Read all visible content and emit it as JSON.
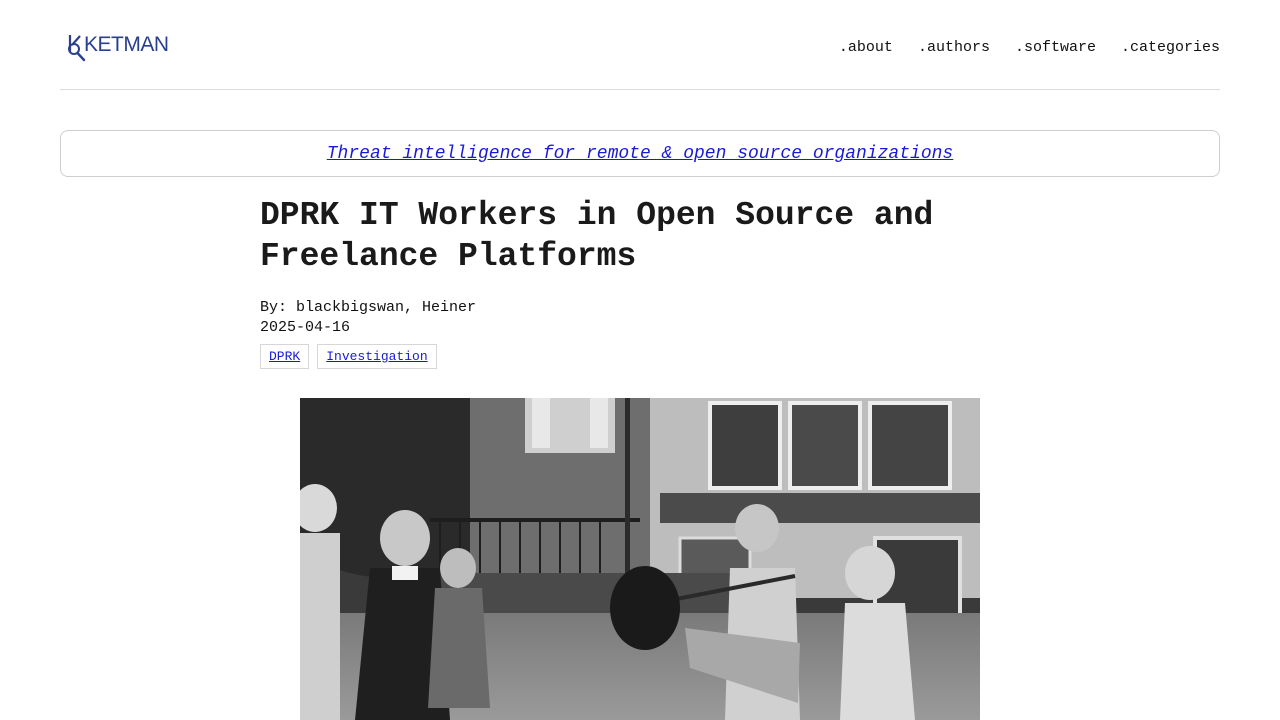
{
  "header": {
    "logo_text": "KETMAN",
    "nav": [
      {
        "label": ".about"
      },
      {
        "label": ".authors"
      },
      {
        "label": ".software"
      },
      {
        "label": ".categories"
      }
    ]
  },
  "banner": {
    "text": "Threat intelligence for remote & open source organizations"
  },
  "article": {
    "title": "DPRK IT Workers in Open Source and Freelance Platforms",
    "byline": "By: blackbigswan, Heiner",
    "date": "2025-04-16",
    "tags": [
      {
        "label": "DPRK"
      },
      {
        "label": "Investigation"
      }
    ]
  },
  "colors": {
    "brand": "#2a3f8f",
    "link": "#1a1ad6"
  }
}
